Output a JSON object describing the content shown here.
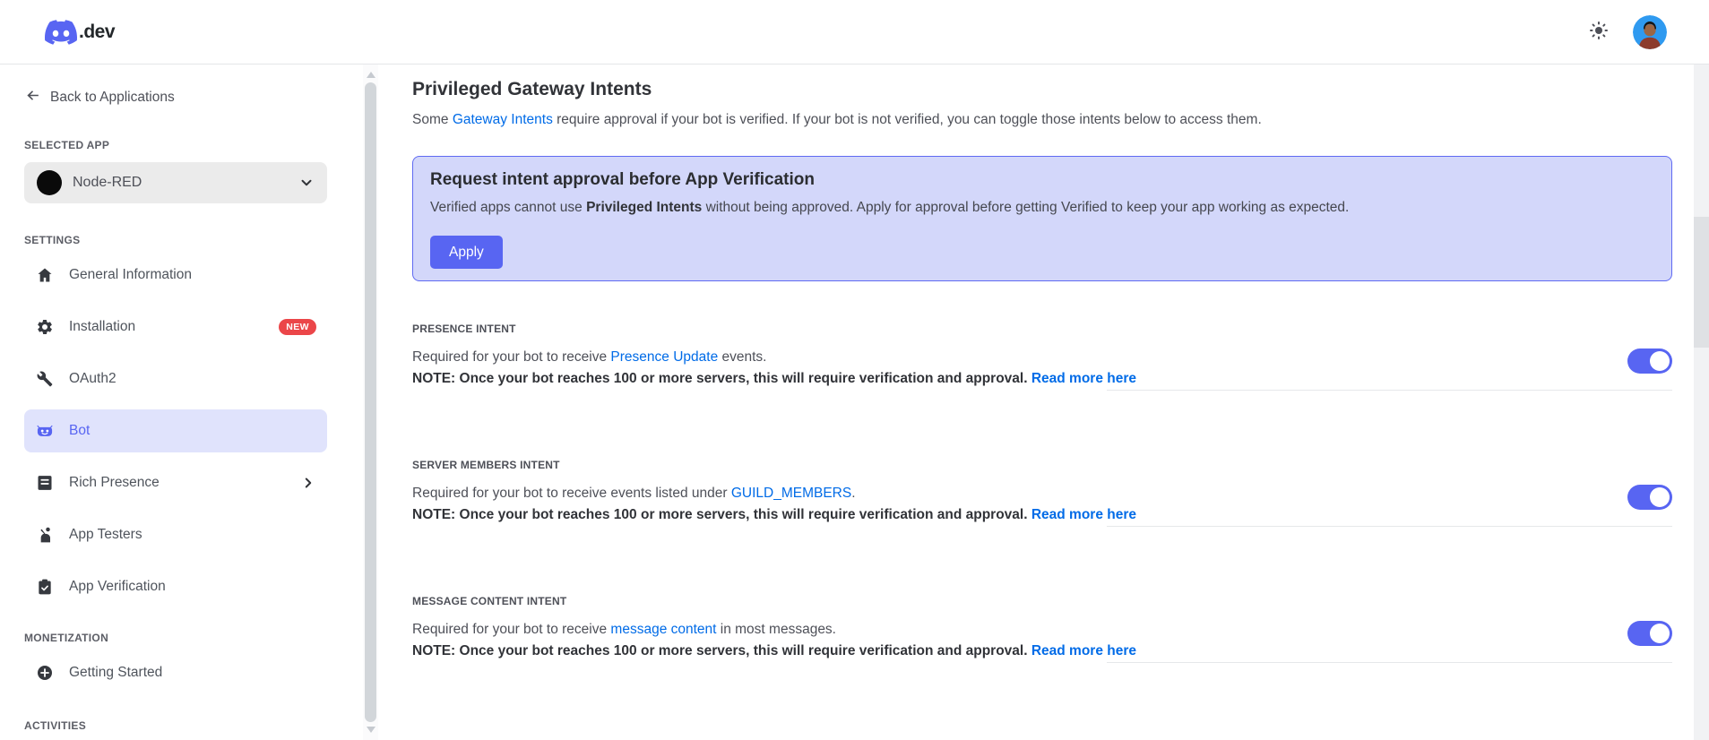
{
  "colors": {
    "accent": "#5865f2",
    "link_blue": "#006be7",
    "banner_background": "#d3d7fa",
    "banner_border": "#5f6af2",
    "badge_red": "#eb4649",
    "selected_item_background": "#e0e3fc",
    "toggle_on": "#5865f2"
  },
  "header": {
    "logo_icon": "discord-logo-icon",
    "logo_text": ".dev",
    "theme_icon": "sun-icon",
    "avatar_icon": "user-avatar"
  },
  "sidebar": {
    "back_label": "Back to Applications",
    "selected_app_heading": "SELECTED APP",
    "app_name": "Node-RED",
    "settings_heading": "SETTINGS",
    "monetization_heading": "MONETIZATION",
    "activities_heading": "ACTIVITIES",
    "settings_items": [
      {
        "label": "General Information",
        "icon": "home-icon"
      },
      {
        "label": "Installation",
        "icon": "gear-icon",
        "badge": "NEW"
      },
      {
        "label": "OAuth2",
        "icon": "wrench-icon"
      },
      {
        "label": "Bot",
        "icon": "robot-icon",
        "selected": true
      },
      {
        "label": "Rich Presence",
        "icon": "journal-icon",
        "chevron": true
      },
      {
        "label": "App Testers",
        "icon": "person-wave-icon"
      },
      {
        "label": "App Verification",
        "icon": "clipboard-check-icon"
      }
    ],
    "monetization_items": [
      {
        "label": "Getting Started",
        "icon": "plus-circle-icon"
      }
    ]
  },
  "main": {
    "title": "Privileged Gateway Intents",
    "intro": [
      {
        "t": "Some "
      },
      {
        "t": "Gateway Intents",
        "link": true
      },
      {
        "t": " require approval if your bot is verified. If your bot is not verified, you can toggle those intents below to access them."
      }
    ],
    "banner": {
      "title": "Request intent approval before App Verification",
      "body": [
        {
          "t": "Verified apps cannot use "
        },
        {
          "t": "Privileged Intents",
          "bold": true
        },
        {
          "t": " without being approved. Apply for approval before getting Verified to keep your app working as expected."
        }
      ],
      "apply_label": "Apply"
    },
    "intents": [
      {
        "label": "PRESENCE INTENT",
        "desc": [
          {
            "t": "Required for your bot to receive "
          },
          {
            "t": "Presence Update",
            "link": true
          },
          {
            "t": " events."
          }
        ],
        "note": [
          {
            "t": "NOTE: Once your bot reaches 100 or more servers, this will require verification and approval. ",
            "bold": true
          },
          {
            "t": "Read more here",
            "link": true,
            "bold": true
          }
        ],
        "enabled": true
      },
      {
        "label": "SERVER MEMBERS INTENT",
        "desc": [
          {
            "t": "Required for your bot to receive events listed under "
          },
          {
            "t": "GUILD_MEMBERS",
            "link": true
          },
          {
            "t": "."
          }
        ],
        "note": [
          {
            "t": "NOTE: Once your bot reaches 100 or more servers, this will require verification and approval. ",
            "bold": true
          },
          {
            "t": "Read more here",
            "link": true,
            "bold": true
          }
        ],
        "enabled": true
      },
      {
        "label": "MESSAGE CONTENT INTENT",
        "desc": [
          {
            "t": "Required for your bot to receive "
          },
          {
            "t": "message content",
            "link": true
          },
          {
            "t": " in most messages."
          }
        ],
        "note": [
          {
            "t": "NOTE: Once your bot reaches 100 or more servers, this will require verification and approval. ",
            "bold": true
          },
          {
            "t": "Read more here",
            "link": true,
            "bold": true
          }
        ],
        "enabled": true
      }
    ]
  }
}
